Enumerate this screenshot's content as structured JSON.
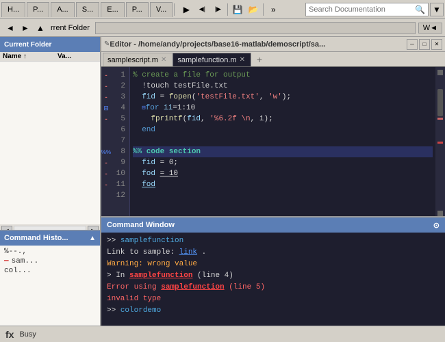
{
  "toolbar": {
    "tabs": [
      "H...",
      "P...",
      "A...",
      "S...",
      "E...",
      "P...",
      "V..."
    ],
    "search_placeholder": "Search Documentation",
    "search_value": ""
  },
  "toolbar2": {
    "current_folder_label": "rrent Folder",
    "workspace_label": "W◄"
  },
  "left_panel": {
    "header": "Current Folder",
    "columns": [
      "Name ↑",
      "Va..."
    ],
    "cmd_history": {
      "header": "Command Histo...",
      "items": [
        "%--.,",
        "sam...",
        "col..."
      ]
    }
  },
  "editor": {
    "title": "Editor - /home/andy/projects/base16-matlab/demoscript/sa...",
    "tabs": [
      {
        "label": "samplescript.m",
        "active": false
      },
      {
        "label": "samplefunction.m",
        "active": true
      }
    ],
    "lines": [
      {
        "num": "1",
        "type": "comment",
        "content": "% create a file for output",
        "indicator": "dash"
      },
      {
        "num": "2",
        "type": "normal",
        "content": "  !touch testFile.txt",
        "indicator": "dash"
      },
      {
        "num": "3",
        "type": "normal",
        "content": "  fid = fopen('testFile.txt', 'w');",
        "indicator": "dash"
      },
      {
        "num": "4",
        "type": "normal",
        "content": "  for ii=1:10",
        "indicator": "collapse"
      },
      {
        "num": "5",
        "type": "normal",
        "content": "    fprintf(fid, '%6.2f \\n, i);",
        "indicator": "dash"
      },
      {
        "num": "6",
        "type": "normal",
        "content": "  end",
        "indicator": ""
      },
      {
        "num": "7",
        "type": "empty",
        "content": "",
        "indicator": ""
      },
      {
        "num": "8",
        "type": "section",
        "content": "%% code section",
        "indicator": "section"
      },
      {
        "num": "9",
        "type": "normal",
        "content": "  fid = 0;",
        "indicator": "dash"
      },
      {
        "num": "10",
        "type": "normal",
        "content": "  fod = 10",
        "indicator": "dash"
      },
      {
        "num": "11",
        "type": "normal",
        "content": "  fod",
        "indicator": "dash"
      },
      {
        "num": "12",
        "type": "empty",
        "content": "",
        "indicator": ""
      }
    ]
  },
  "command_window": {
    "header": "Command Window",
    "lines": [
      {
        "type": "prompt",
        "text": ">> samplefunction"
      },
      {
        "type": "link-line",
        "prefix": "Link to sample: ",
        "link": "link",
        "suffix": "."
      },
      {
        "type": "warning",
        "text": "Warning: wrong value"
      },
      {
        "type": "in-fn",
        "text": "> In samplefunction (line 4)"
      },
      {
        "type": "error",
        "text": "Error using samplefunction (line 5)"
      },
      {
        "type": "error-msg",
        "text": "invalid type"
      },
      {
        "type": "prompt",
        "text": ">> colordemo"
      }
    ]
  },
  "status_bar": {
    "fx_label": "fx",
    "status": "Busy"
  },
  "icons": {
    "play": "▶",
    "search": "🔍",
    "funnel": "▼",
    "close": "✕",
    "minimize": "─",
    "maximize": "□",
    "arrow_left": "◄",
    "arrow_right": "►",
    "arrow_up": "▲",
    "arrow_down": "▼",
    "expand": "⊞",
    "collapse_icon": "⊟",
    "circle": "●",
    "down_icon": "⊙"
  }
}
